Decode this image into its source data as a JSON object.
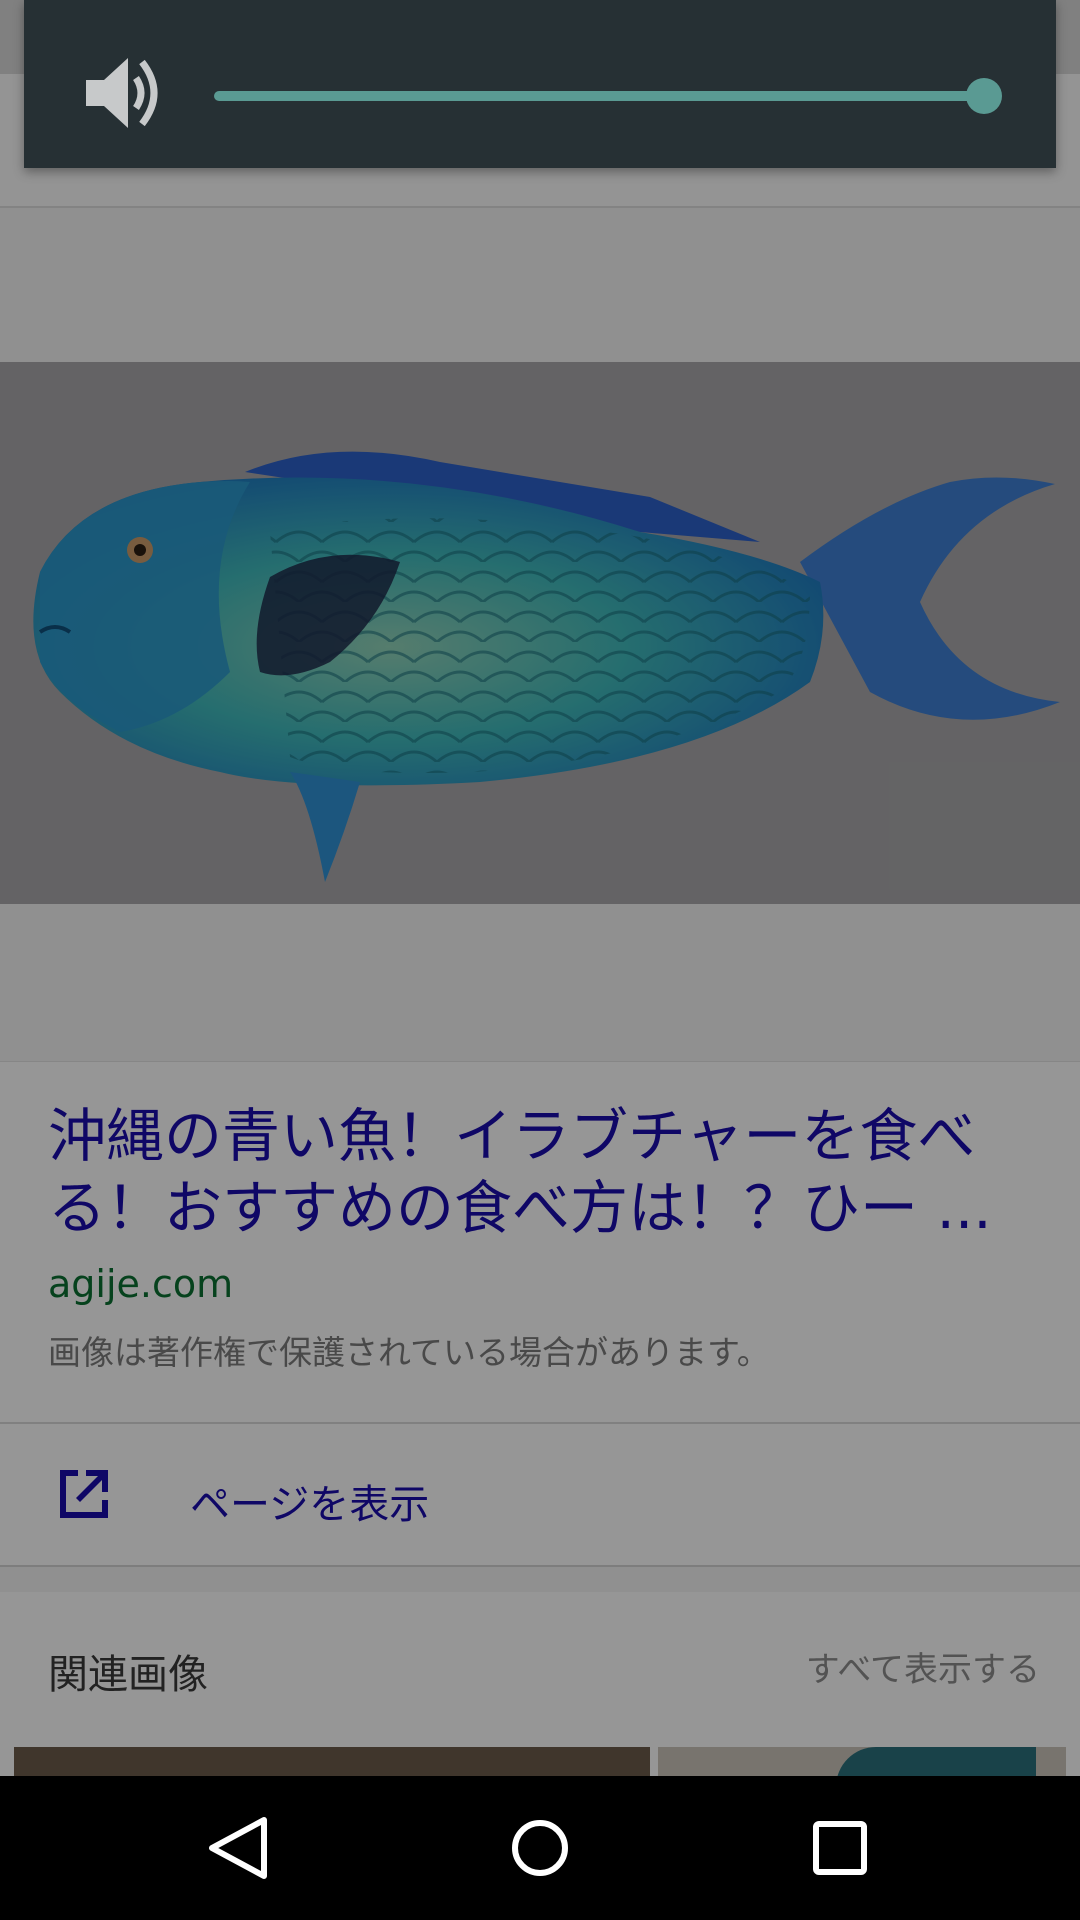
{
  "volume": {
    "level": 1.0,
    "icon": "speaker-icon",
    "accent_color": "#5a9a93"
  },
  "result": {
    "title": "沖縄の青い魚！イラブチャーを食べる！おすすめの食べ方は！？ひー ...",
    "domain": "agije.com",
    "copyright_note": "画像は著作権で保護されている場合があります。",
    "visit_label": "ページを表示",
    "visit_icon": "open-in-new-icon",
    "link_color": "#1a0dab",
    "domain_color": "#0a6e31"
  },
  "related": {
    "title": "関連画像",
    "view_all": "すべて表示する"
  },
  "navbar": {
    "back_icon": "back-triangle-icon",
    "home_icon": "home-circle-icon",
    "recents_icon": "recents-square-icon"
  }
}
